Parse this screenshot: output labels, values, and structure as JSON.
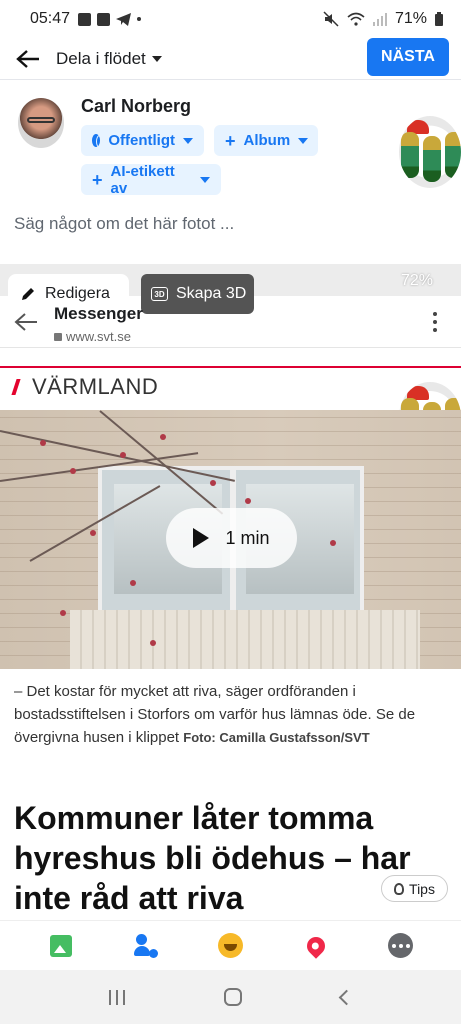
{
  "status_bar": {
    "time": "05:47",
    "battery": "71%"
  },
  "header": {
    "title": "Dela i flödet",
    "next_label": "NÄSTA"
  },
  "composer": {
    "user_name": "Carl Norberg",
    "audience_label": "Offentligt",
    "album_label": "Album",
    "ai_label": "AI-etikett av",
    "caption_placeholder": "Säg något om det här fotot ..."
  },
  "editor_tabs": {
    "edit_label": "Redigera",
    "create3d_label": "Skapa 3D",
    "badge_3d": "3D"
  },
  "embedded_screenshot": {
    "battery": "72%",
    "nav_title": "Messenger",
    "url": "www.svt.se",
    "region": "VÄRMLAND",
    "video_duration": "1 min",
    "photo_caption": "– Det kostar för mycket att riva, säger ordföranden i bostadsstiftelsen i Storfors om varför hus lämnas öde. Se de övergivna husen i klippet",
    "photo_credit": "Foto: Camilla Gustafsson/SVT",
    "headline": "Kommuner låter tomma hyreshus bli ödehus – har inte råd att riva",
    "tips_label": "Tips"
  },
  "bottom_actions": [
    "photo-video-icon",
    "tag-people-icon",
    "feeling-icon",
    "check-in-icon",
    "more-icon"
  ],
  "colors": {
    "accent": "#1877f2",
    "svt_red": "#e4032e",
    "chip_bg": "#e7f3ff"
  }
}
